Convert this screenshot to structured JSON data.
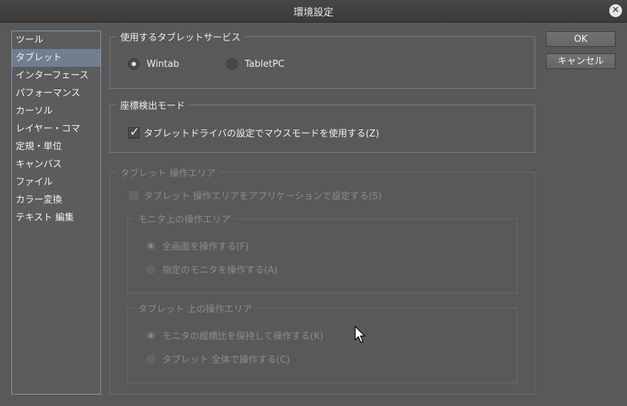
{
  "window": {
    "title": "環境設定",
    "close_icon": "close-icon"
  },
  "categories": [
    {
      "label": "ツール",
      "selected": false
    },
    {
      "label": "タブレット",
      "selected": true
    },
    {
      "label": "インターフェース",
      "selected": false
    },
    {
      "label": "パフォーマンス",
      "selected": false
    },
    {
      "label": "カーソル",
      "selected": false
    },
    {
      "label": "レイヤー・コマ",
      "selected": false
    },
    {
      "label": "定規・単位",
      "selected": false
    },
    {
      "label": "キャンバス",
      "selected": false
    },
    {
      "label": "ファイル",
      "selected": false
    },
    {
      "label": "カラー変換",
      "selected": false
    },
    {
      "label": "テキスト 編集",
      "selected": false
    }
  ],
  "buttons": {
    "ok": "OK",
    "cancel": "キャンセル"
  },
  "tablet_service": {
    "title": "使用するタブレットサービス",
    "wintab": "Wintab",
    "tabletpc": "TabletPC",
    "selected": "Wintab"
  },
  "coordinate_mode": {
    "title": "座標検出モード",
    "mouse_mode_label": "タブレットドライバの設定でマウスモードを使用する(Z)",
    "mouse_mode_checked": true
  },
  "tablet_area": {
    "title": "タブレット 操作エリア",
    "app_setting_label": "タブレット 操作エリアをアプリケーションで設定する(S)",
    "app_setting_checked": false,
    "monitor_area": {
      "title": "モニタ上の操作エリア",
      "full_screen": "全画面を操作する(F)",
      "specific_monitor": "指定のモニタを操作する(A)",
      "selected": "full_screen"
    },
    "tablet_area_group": {
      "title": "タブレット 上の操作エリア",
      "keep_ratio": "モニタの縦横比を保持して操作する(K)",
      "whole_tablet": "タブレット 全体で操作する(C)",
      "selected": "keep_ratio"
    }
  },
  "colors": {
    "selection": "#6f7f8f",
    "list_border": "#7a9bb8",
    "background": "#595959"
  }
}
